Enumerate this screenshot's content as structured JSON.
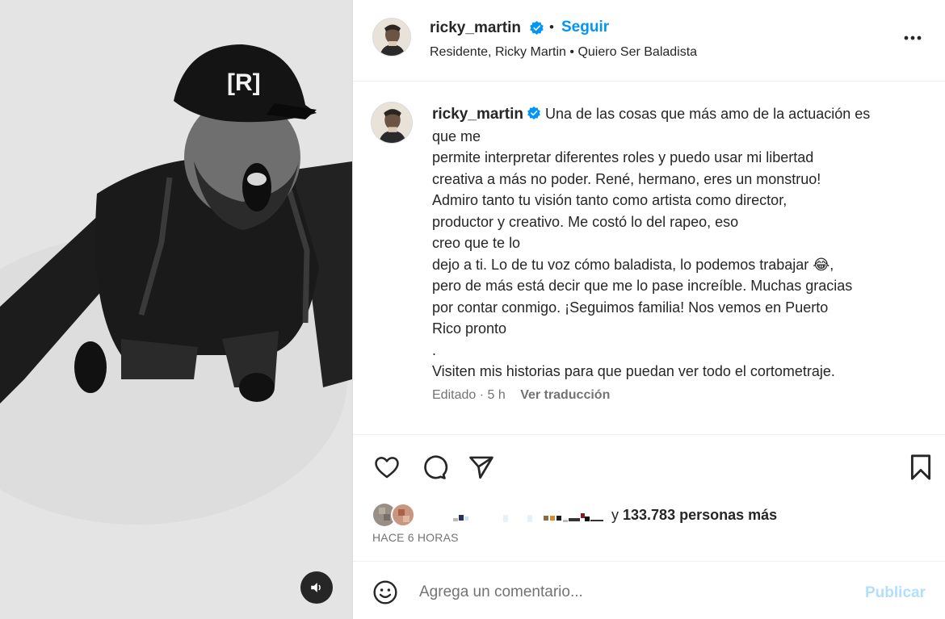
{
  "post": {
    "media": {
      "cap_logo": "[R]",
      "mute_icon": "speaker-icon"
    },
    "header": {
      "username": "ricky_martin",
      "separator": "•",
      "follow_label": "Seguir",
      "subtitle": "Residente, Ricky Martin • Quiero Ser Baladista"
    },
    "caption": {
      "username": "ricky_martin",
      "text": " Una de las cosas que más amo de la actuación es\nque me\npermite interpretar diferentes roles y puedo usar mi libertad\ncreativa a más no poder. René, hermano, eres un monstruo!\nAdmiro tanto tu visión tanto como artista como director,\nproductor y creativo. Me costó lo del rapeo, eso\ncreo que te lo\ndejo a ti. Lo de tu voz cómo baladista, lo podemos trabajar 😂,\npero de más está decir que me lo pase increíble. Muchas gracias\npor contar conmigo. ¡Seguimos familia! Nos vemos en Puerto\nRico pronto\n.\nVisiten mis historias para que puedan ver todo el cortometraje.",
      "edited": "Editado · 5 h",
      "translate": "Ver traducción"
    },
    "likes": {
      "prefix": "y ",
      "count": "133.783 personas más"
    },
    "time": "HACE 6 HORAS",
    "comment": {
      "placeholder": "Agrega un comentario...",
      "publish": "Publicar"
    },
    "colors": {
      "link": "#0095f6",
      "verified": "#0095f6",
      "publish_disabled": "#b2dffc",
      "muted_text": "#737373"
    }
  }
}
